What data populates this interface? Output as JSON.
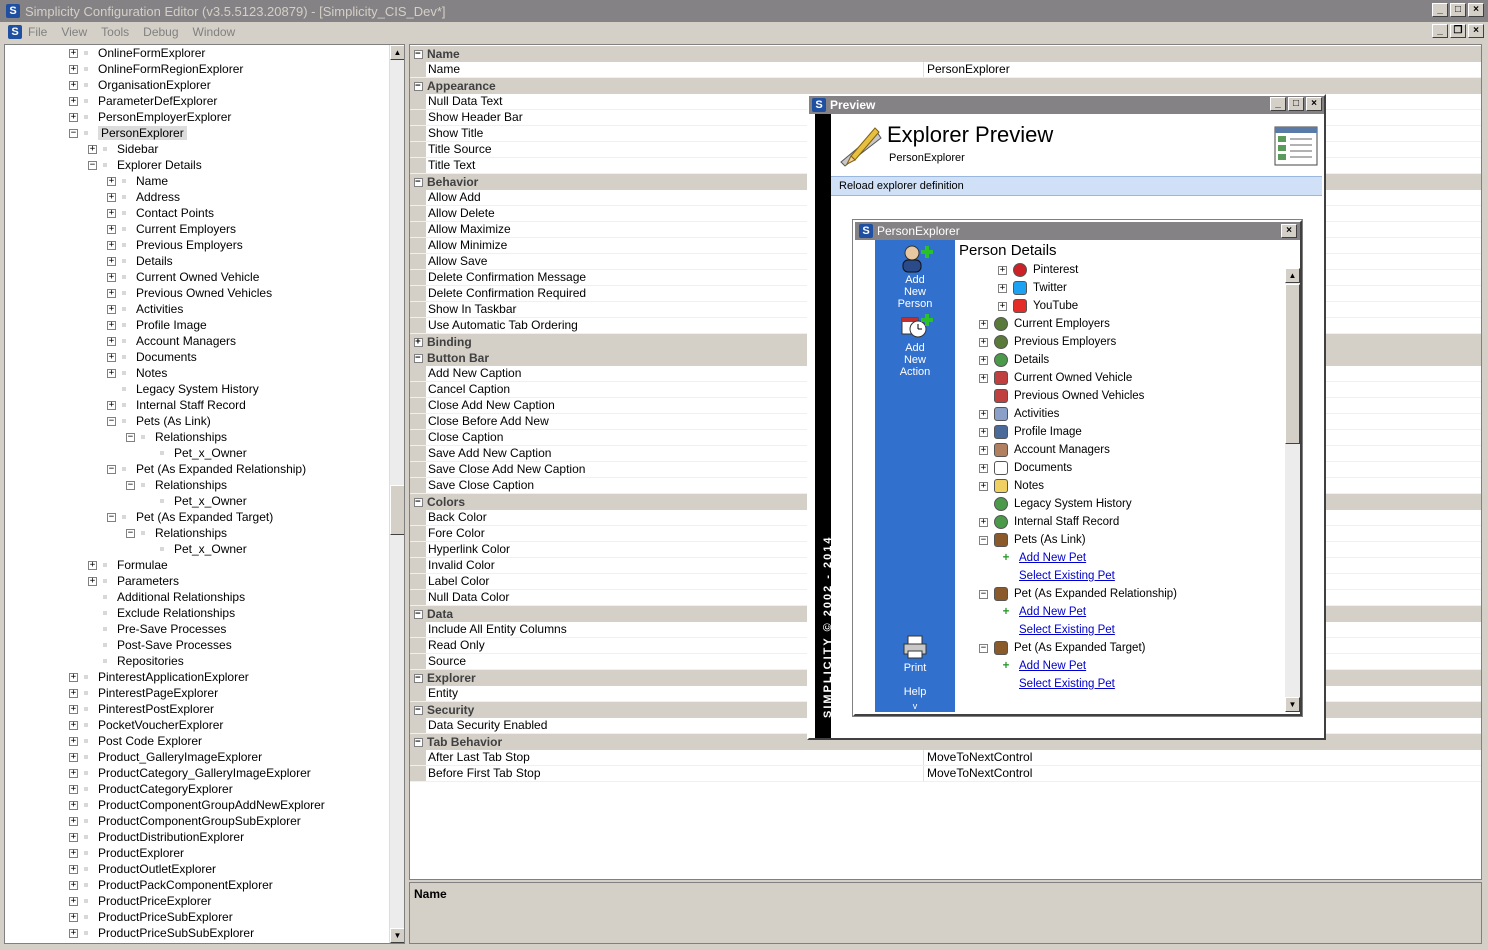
{
  "window": {
    "title": "Simplicity Configuration Editor (v3.5.5123.20879) - [Simplicity_CIS_Dev*]"
  },
  "menu": [
    "File",
    "View",
    "Tools",
    "Debug",
    "Window"
  ],
  "tree": [
    {
      "level": 0,
      "label": "OnlineFormExplorer",
      "exp": "+"
    },
    {
      "level": 0,
      "label": "OnlineFormRegionExplorer",
      "exp": "+"
    },
    {
      "level": 0,
      "label": "OrganisationExplorer",
      "exp": "+"
    },
    {
      "level": 0,
      "label": "ParameterDefExplorer",
      "exp": "+"
    },
    {
      "level": 0,
      "label": "PersonEmployerExplorer",
      "exp": "+"
    },
    {
      "level": 0,
      "label": "PersonExplorer",
      "exp": "-",
      "selected": true
    },
    {
      "level": 1,
      "label": "Sidebar",
      "exp": "+"
    },
    {
      "level": 1,
      "label": "Explorer Details",
      "exp": "-"
    },
    {
      "level": 2,
      "label": "Name",
      "exp": "+"
    },
    {
      "level": 2,
      "label": "Address",
      "exp": "+"
    },
    {
      "level": 2,
      "label": "Contact Points",
      "exp": "+"
    },
    {
      "level": 2,
      "label": "Current Employers",
      "exp": "+"
    },
    {
      "level": 2,
      "label": "Previous Employers",
      "exp": "+"
    },
    {
      "level": 2,
      "label": "Details",
      "exp": "+"
    },
    {
      "level": 2,
      "label": "Current Owned Vehicle",
      "exp": "+"
    },
    {
      "level": 2,
      "label": "Previous Owned Vehicles",
      "exp": "+"
    },
    {
      "level": 2,
      "label": "Activities",
      "exp": "+"
    },
    {
      "level": 2,
      "label": "Profile Image",
      "exp": "+"
    },
    {
      "level": 2,
      "label": "Account Managers",
      "exp": "+"
    },
    {
      "level": 2,
      "label": "Documents",
      "exp": "+"
    },
    {
      "level": 2,
      "label": "Notes",
      "exp": "+"
    },
    {
      "level": 2,
      "label": "Legacy System History",
      "exp": ""
    },
    {
      "level": 2,
      "label": "Internal Staff Record",
      "exp": "+"
    },
    {
      "level": 2,
      "label": "Pets (As Link)",
      "exp": "-"
    },
    {
      "level": 3,
      "label": "Relationships",
      "exp": "-"
    },
    {
      "level": 4,
      "label": "Pet_x_Owner",
      "exp": ""
    },
    {
      "level": 2,
      "label": "Pet (As Expanded Relationship)",
      "exp": "-"
    },
    {
      "level": 3,
      "label": "Relationships",
      "exp": "-"
    },
    {
      "level": 4,
      "label": "Pet_x_Owner",
      "exp": ""
    },
    {
      "level": 2,
      "label": "Pet (As Expanded Target)",
      "exp": "-"
    },
    {
      "level": 3,
      "label": "Relationships",
      "exp": "-"
    },
    {
      "level": 4,
      "label": "Pet_x_Owner",
      "exp": ""
    },
    {
      "level": 1,
      "label": "Formulae",
      "exp": "+"
    },
    {
      "level": 1,
      "label": "Parameters",
      "exp": "+"
    },
    {
      "level": 1,
      "label": "Additional Relationships",
      "exp": ""
    },
    {
      "level": 1,
      "label": "Exclude Relationships",
      "exp": ""
    },
    {
      "level": 1,
      "label": "Pre-Save Processes",
      "exp": ""
    },
    {
      "level": 1,
      "label": "Post-Save Processes",
      "exp": ""
    },
    {
      "level": 1,
      "label": "Repositories",
      "exp": ""
    },
    {
      "level": 0,
      "label": "PinterestApplicationExplorer",
      "exp": "+"
    },
    {
      "level": 0,
      "label": "PinterestPageExplorer",
      "exp": "+"
    },
    {
      "level": 0,
      "label": "PinterestPostExplorer",
      "exp": "+"
    },
    {
      "level": 0,
      "label": "PocketVoucherExplorer",
      "exp": "+"
    },
    {
      "level": 0,
      "label": "Post Code Explorer",
      "exp": "+"
    },
    {
      "level": 0,
      "label": "Product_GalleryImageExplorer",
      "exp": "+"
    },
    {
      "level": 0,
      "label": "ProductCategory_GalleryImageExplorer",
      "exp": "+"
    },
    {
      "level": 0,
      "label": "ProductCategoryExplorer",
      "exp": "+"
    },
    {
      "level": 0,
      "label": "ProductComponentGroupAddNewExplorer",
      "exp": "+"
    },
    {
      "level": 0,
      "label": "ProductComponentGroupSubExplorer",
      "exp": "+"
    },
    {
      "level": 0,
      "label": "ProductDistributionExplorer",
      "exp": "+"
    },
    {
      "level": 0,
      "label": "ProductExplorer",
      "exp": "+"
    },
    {
      "level": 0,
      "label": "ProductOutletExplorer",
      "exp": "+"
    },
    {
      "level": 0,
      "label": "ProductPackComponentExplorer",
      "exp": "+"
    },
    {
      "level": 0,
      "label": "ProductPriceExplorer",
      "exp": "+"
    },
    {
      "level": 0,
      "label": "ProductPriceSubExplorer",
      "exp": "+"
    },
    {
      "level": 0,
      "label": "ProductPriceSubSubExplorer",
      "exp": "+"
    }
  ],
  "grid": [
    {
      "cat": "Name"
    },
    {
      "name": "Name",
      "value": "PersonExplorer"
    },
    {
      "cat": "Appearance"
    },
    {
      "name": "Null Data Text",
      "value": ""
    },
    {
      "name": "Show Header Bar",
      "value": ""
    },
    {
      "name": "Show Title",
      "value": ""
    },
    {
      "name": "Title Source",
      "value": ""
    },
    {
      "name": "Title Text",
      "value": ""
    },
    {
      "cat": "Behavior"
    },
    {
      "name": "Allow Add",
      "value": ""
    },
    {
      "name": "Allow Delete",
      "value": ""
    },
    {
      "name": "Allow Maximize",
      "value": ""
    },
    {
      "name": "Allow Minimize",
      "value": ""
    },
    {
      "name": "Allow Save",
      "value": ""
    },
    {
      "name": "Delete Confirmation Message",
      "value": ""
    },
    {
      "name": "Delete Confirmation Required",
      "value": ""
    },
    {
      "name": "Show In Taskbar",
      "value": ""
    },
    {
      "name": "Use Automatic Tab Ordering",
      "value": ""
    },
    {
      "cat": "Binding",
      "collapsed": true
    },
    {
      "cat": "Button Bar"
    },
    {
      "name": "Add New Caption",
      "value": ""
    },
    {
      "name": "Cancel Caption",
      "value": ""
    },
    {
      "name": "Close Add New Caption",
      "value": ""
    },
    {
      "name": "Close Before Add New",
      "value": ""
    },
    {
      "name": "Close Caption",
      "value": ""
    },
    {
      "name": "Save Add New Caption",
      "value": ""
    },
    {
      "name": "Save Close Add New Caption",
      "value": ""
    },
    {
      "name": "Save Close Caption",
      "value": ""
    },
    {
      "cat": "Colors"
    },
    {
      "name": "Back Color",
      "value": ""
    },
    {
      "name": "Fore Color",
      "value": ""
    },
    {
      "name": "Hyperlink Color",
      "value": ""
    },
    {
      "name": "Invalid Color",
      "value": ""
    },
    {
      "name": "Label Color",
      "value": ""
    },
    {
      "name": "Null Data Color",
      "value": ""
    },
    {
      "cat": "Data"
    },
    {
      "name": "Include All Entity Columns",
      "value": ""
    },
    {
      "name": "Read Only",
      "value": ""
    },
    {
      "name": "Source",
      "value": ""
    },
    {
      "cat": "Explorer"
    },
    {
      "name": "Entity",
      "value": ""
    },
    {
      "cat": "Security"
    },
    {
      "name": "Data Security Enabled",
      "value": ""
    },
    {
      "cat": "Tab Behavior"
    },
    {
      "name": "After Last Tab Stop",
      "value": "MoveToNextControl"
    },
    {
      "name": "Before First Tab Stop",
      "value": "MoveToNextControl"
    }
  ],
  "description": {
    "title": "Name"
  },
  "preview": {
    "window_title": "Preview",
    "header_title": "Explorer Preview",
    "header_subtitle": "PersonExplorer",
    "reload": "Reload explorer definition",
    "brand": "SIMPLICITY © 2002 - 2014",
    "inner": {
      "title": "PersonExplorer",
      "heading": "Person Details",
      "sidebar": {
        "add_person": "Add New Person",
        "add_action": "Add New Action",
        "print": "Print",
        "help": "Help"
      },
      "rows": [
        {
          "indent": 1,
          "exp": "+",
          "icon": "pinterest-icon",
          "color": "#cc2127",
          "label": "Pinterest"
        },
        {
          "indent": 1,
          "exp": "+",
          "icon": "twitter-icon",
          "color": "#1da1f2",
          "label": "Twitter"
        },
        {
          "indent": 1,
          "exp": "+",
          "icon": "youtube-icon",
          "color": "#e52d27",
          "label": "YouTube"
        },
        {
          "indent": 0,
          "exp": "+",
          "icon": "people-icon",
          "color": "#5a7a3a",
          "label": "Current Employers"
        },
        {
          "indent": 0,
          "exp": "+",
          "icon": "people-icon",
          "color": "#5a7a3a",
          "label": "Previous Employers"
        },
        {
          "indent": 0,
          "exp": "+",
          "icon": "globe-icon",
          "color": "#4a9a4a",
          "label": "Details"
        },
        {
          "indent": 0,
          "exp": "+",
          "icon": "car-icon",
          "color": "#c04040",
          "label": "Current Owned Vehicle"
        },
        {
          "indent": 0,
          "exp": "",
          "icon": "car-icon",
          "color": "#c04040",
          "label": "Previous Owned Vehicles"
        },
        {
          "indent": 0,
          "exp": "+",
          "icon": "search-icon",
          "color": "#8aa0c8",
          "label": "Activities"
        },
        {
          "indent": 0,
          "exp": "+",
          "icon": "image-icon",
          "color": "#4a6a9a",
          "label": "Profile Image"
        },
        {
          "indent": 0,
          "exp": "+",
          "icon": "handshake-icon",
          "color": "#b08060",
          "label": "Account Managers"
        },
        {
          "indent": 0,
          "exp": "+",
          "icon": "document-icon",
          "color": "#ffffff",
          "label": "Documents"
        },
        {
          "indent": 0,
          "exp": "+",
          "icon": "notes-icon",
          "color": "#f0d060",
          "label": "Notes"
        },
        {
          "indent": 0,
          "exp": "",
          "icon": "globe-icon",
          "color": "#4a9a4a",
          "label": "Legacy System History"
        },
        {
          "indent": 0,
          "exp": "+",
          "icon": "globe-icon",
          "color": "#4a9a4a",
          "label": "Internal Staff Record"
        },
        {
          "indent": 0,
          "exp": "-",
          "icon": "pet-icon",
          "color": "#8a5a2a",
          "label": "Pets (As Link)"
        },
        {
          "indent": 1,
          "exp": "",
          "icon": "add-icon",
          "color": "#2a9a2a",
          "label": "Add New Pet",
          "link": true
        },
        {
          "indent": 1,
          "exp": "",
          "icon": "",
          "color": "",
          "label": "Select Existing Pet",
          "link": true
        },
        {
          "indent": 0,
          "exp": "-",
          "icon": "pet-icon",
          "color": "#8a5a2a",
          "label": "Pet (As Expanded Relationship)"
        },
        {
          "indent": 1,
          "exp": "",
          "icon": "add-icon",
          "color": "#2a9a2a",
          "label": "Add New Pet",
          "link": true
        },
        {
          "indent": 1,
          "exp": "",
          "icon": "",
          "color": "",
          "label": "Select Existing Pet",
          "link": true
        },
        {
          "indent": 0,
          "exp": "-",
          "icon": "pet-icon",
          "color": "#8a5a2a",
          "label": "Pet (As Expanded Target)"
        },
        {
          "indent": 1,
          "exp": "",
          "icon": "add-icon",
          "color": "#2a9a2a",
          "label": "Add New Pet",
          "link": true
        },
        {
          "indent": 1,
          "exp": "",
          "icon": "",
          "color": "",
          "label": "Select Existing Pet",
          "link": true
        }
      ]
    }
  }
}
